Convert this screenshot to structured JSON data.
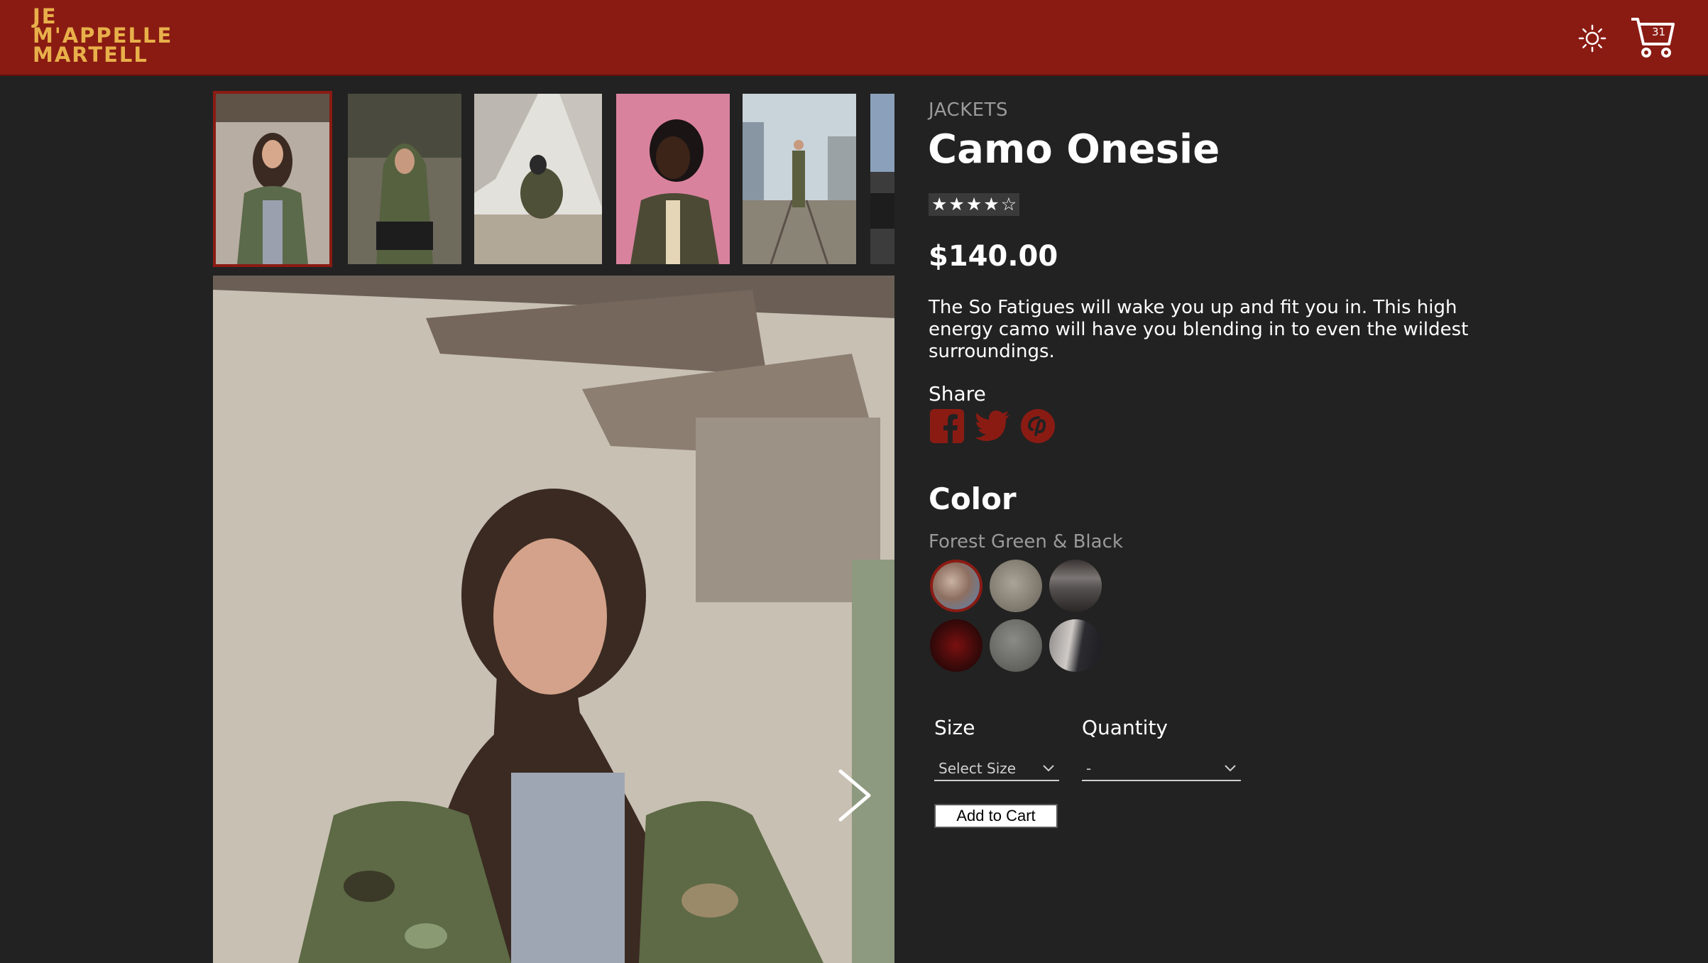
{
  "header": {
    "logo_lines": [
      "JE",
      "M'APPELLE",
      "MARTELL"
    ],
    "cart_count": "31",
    "brand_color": "#8a1b13",
    "logo_color": "#e8b04a"
  },
  "gallery": {
    "thumbnails": [
      {
        "name": "thumb-1",
        "selected": true
      },
      {
        "name": "thumb-2",
        "selected": false
      },
      {
        "name": "thumb-3",
        "selected": false
      },
      {
        "name": "thumb-4",
        "selected": false
      },
      {
        "name": "thumb-5",
        "selected": false
      },
      {
        "name": "thumb-6",
        "selected": false
      }
    ],
    "next_icon": "chevron-right-icon"
  },
  "product": {
    "category": "JACKETS",
    "title": "Camo Onesie",
    "rating": 4,
    "rating_max": 5,
    "price": "$140.00",
    "description": "The So Fatigues will wake you up and fit you in. This high energy camo will have you blending in to even the wildest surroundings."
  },
  "share": {
    "label": "Share",
    "icons": [
      "facebook-icon",
      "twitter-icon",
      "pinterest-icon"
    ]
  },
  "color": {
    "heading": "Color",
    "selected_name": "Forest Green & Black",
    "swatch_count": 6
  },
  "purchase": {
    "size_label": "Size",
    "size_value": "Select Size",
    "quantity_label": "Quantity",
    "quantity_value": "-",
    "add_to_cart_label": "Add to Cart"
  }
}
